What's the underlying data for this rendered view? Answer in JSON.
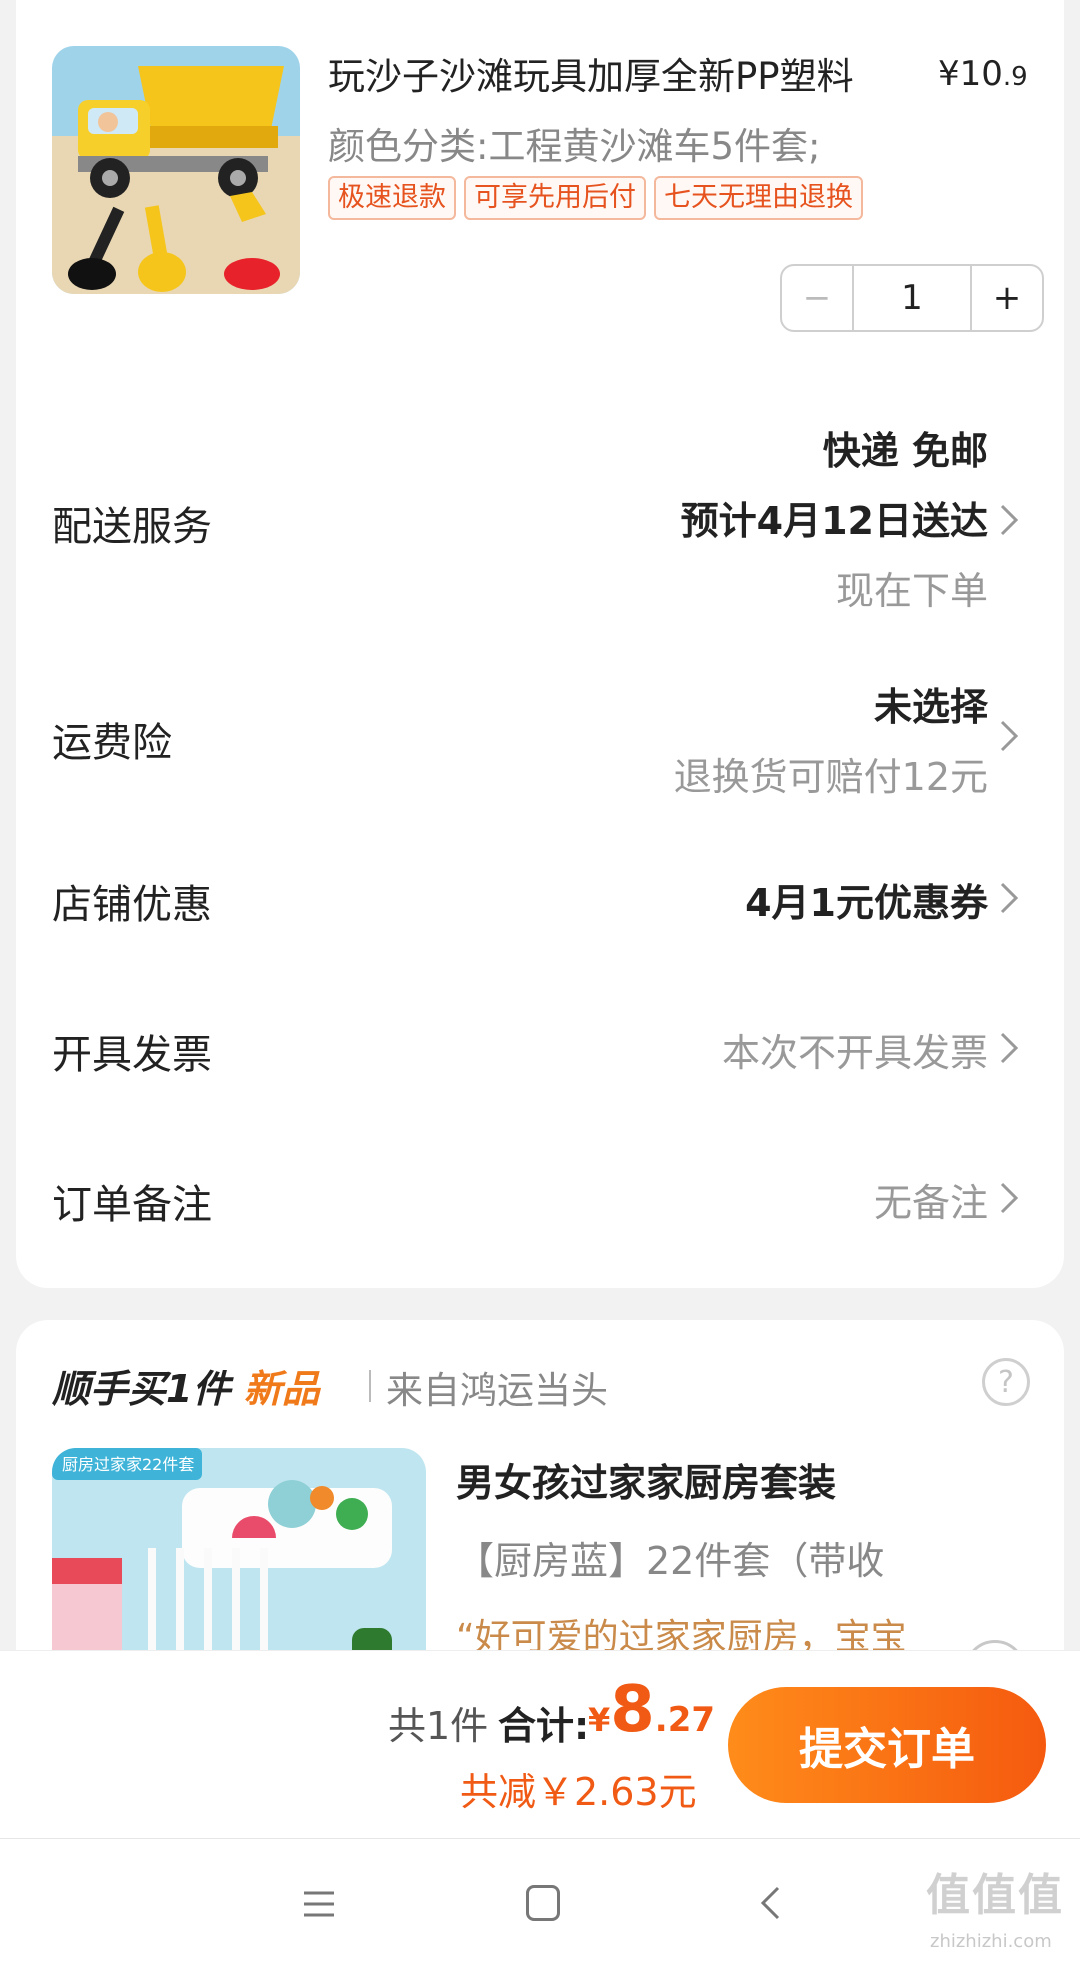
{
  "product": {
    "title": "玩沙子沙滩玩具加厚全新PP塑料",
    "price_symbol": "¥",
    "price_int": "10",
    "price_dec": ".9",
    "variant": "颜色分类:工程黄沙滩车5件套;",
    "tags": [
      "极速退款",
      "可享先用后付",
      "七天无理由退换"
    ],
    "quantity": "1",
    "minus": "−",
    "plus": "+"
  },
  "delivery": {
    "label": "配送服务",
    "method": "快递 免邮",
    "eta": "预计4月12日送达",
    "note": "现在下单"
  },
  "insurance": {
    "label": "运费险",
    "status": "未选择",
    "desc": "退换货可赔付12元"
  },
  "discount": {
    "label": "店铺优惠",
    "value": "4月1元优惠券"
  },
  "invoice": {
    "label": "开具发票",
    "value": "本次不开具发票"
  },
  "remark": {
    "label": "订单备注",
    "value": "无备注"
  },
  "recommend": {
    "header_prefix": "顺手买1件",
    "header_new": "新品",
    "store": "来自鸿运当头",
    "help": "?",
    "image_banner": "厨房过家家22件套",
    "title": "男女孩过家家厨房套装",
    "variant": "【厨房蓝】22件套（带收",
    "review": "“好可爱的过家家厨房，宝宝"
  },
  "checkout": {
    "count": "共1件",
    "total_label": "合计:",
    "total_symbol": "¥",
    "total_int": "8",
    "total_dec": ".27",
    "saved": "共减￥2.63元",
    "submit": "提交订单"
  },
  "watermark": {
    "logo": "值值值",
    "url": "zhizhizhi.com"
  },
  "colors": {
    "accent": "#f05a14",
    "button_start": "#ff8c1a",
    "button_end": "#f55a0f",
    "tag_border": "#f4b89d"
  }
}
